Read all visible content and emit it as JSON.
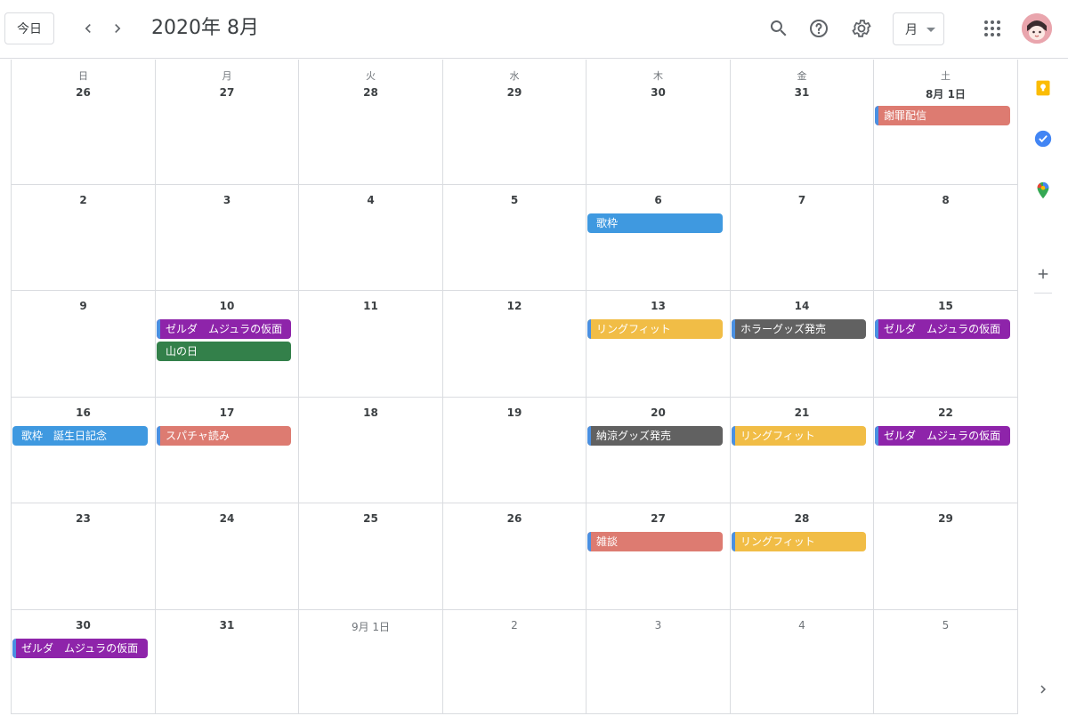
{
  "header": {
    "today_label": "今日",
    "title": "2020年 8月",
    "view_label": "月"
  },
  "icons": {
    "prev": "chevron-left-icon",
    "next": "chevron-right-icon",
    "search": "search-icon",
    "help": "help-icon",
    "settings": "gear-icon",
    "apps": "apps-grid-icon",
    "avatar": "avatar",
    "keep": "keep-icon",
    "tasks": "tasks-icon",
    "maps": "maps-icon",
    "add": "plus-icon",
    "expand": "chevron-right-icon"
  },
  "weekdays": [
    "日",
    "月",
    "火",
    "水",
    "木",
    "金",
    "土"
  ],
  "colors": {
    "purple": "#8e24aa",
    "green": "#33804a",
    "yellow": "#f1bd46",
    "gray": "#616161",
    "salmon": "#dd7b71",
    "blue": "#3f99e0",
    "stripe": "#4a90e2",
    "grid_line": "#dadce0"
  },
  "weeks": [
    {
      "days": [
        {
          "label": "26"
        },
        {
          "label": "27"
        },
        {
          "label": "28"
        },
        {
          "label": "29"
        },
        {
          "label": "30"
        },
        {
          "label": "31"
        },
        {
          "label": "8月 1日",
          "events": [
            {
              "title": "謝罪配信",
              "color": "salmon"
            }
          ]
        }
      ]
    },
    {
      "days": [
        {
          "label": "2"
        },
        {
          "label": "3"
        },
        {
          "label": "4"
        },
        {
          "label": "5"
        },
        {
          "label": "6",
          "events": [
            {
              "title": "歌枠",
              "color": "blue",
              "stripe": false
            }
          ]
        },
        {
          "label": "7"
        },
        {
          "label": "8"
        }
      ]
    },
    {
      "days": [
        {
          "label": "9"
        },
        {
          "label": "10",
          "events": [
            {
              "title": "ゼルダ　ムジュラの仮面",
              "color": "purple"
            },
            {
              "title": "山の日",
              "color": "green",
              "stripe": false
            }
          ]
        },
        {
          "label": "11"
        },
        {
          "label": "12"
        },
        {
          "label": "13",
          "events": [
            {
              "title": "リングフィット",
              "color": "yellow"
            }
          ]
        },
        {
          "label": "14",
          "events": [
            {
              "title": "ホラーグッズ発売",
              "color": "gray"
            }
          ]
        },
        {
          "label": "15",
          "events": [
            {
              "title": "ゼルダ　ムジュラの仮面",
              "color": "purple"
            }
          ]
        }
      ]
    },
    {
      "days": [
        {
          "label": "16",
          "events": [
            {
              "title": "歌枠　誕生日記念",
              "color": "blue",
              "stripe": false
            }
          ]
        },
        {
          "label": "17",
          "events": [
            {
              "title": "スパチャ読み",
              "color": "salmon"
            }
          ]
        },
        {
          "label": "18"
        },
        {
          "label": "19"
        },
        {
          "label": "20",
          "events": [
            {
              "title": "納涼グッズ発売",
              "color": "gray"
            }
          ]
        },
        {
          "label": "21",
          "events": [
            {
              "title": "リングフィット",
              "color": "yellow"
            }
          ]
        },
        {
          "label": "22",
          "events": [
            {
              "title": "ゼルダ　ムジュラの仮面",
              "color": "purple"
            }
          ]
        }
      ]
    },
    {
      "days": [
        {
          "label": "23"
        },
        {
          "label": "24"
        },
        {
          "label": "25"
        },
        {
          "label": "26"
        },
        {
          "label": "27",
          "events": [
            {
              "title": "雑談",
              "color": "salmon"
            }
          ]
        },
        {
          "label": "28",
          "events": [
            {
              "title": "リングフィット",
              "color": "yellow"
            }
          ]
        },
        {
          "label": "29"
        }
      ]
    },
    {
      "days": [
        {
          "label": "30",
          "events": [
            {
              "title": "ゼルダ　ムジュラの仮面",
              "color": "purple"
            }
          ]
        },
        {
          "label": "31"
        },
        {
          "label": "9月 1日",
          "muted": true
        },
        {
          "label": "2",
          "muted": true
        },
        {
          "label": "3",
          "muted": true
        },
        {
          "label": "4",
          "muted": true
        },
        {
          "label": "5",
          "muted": true
        }
      ]
    }
  ]
}
